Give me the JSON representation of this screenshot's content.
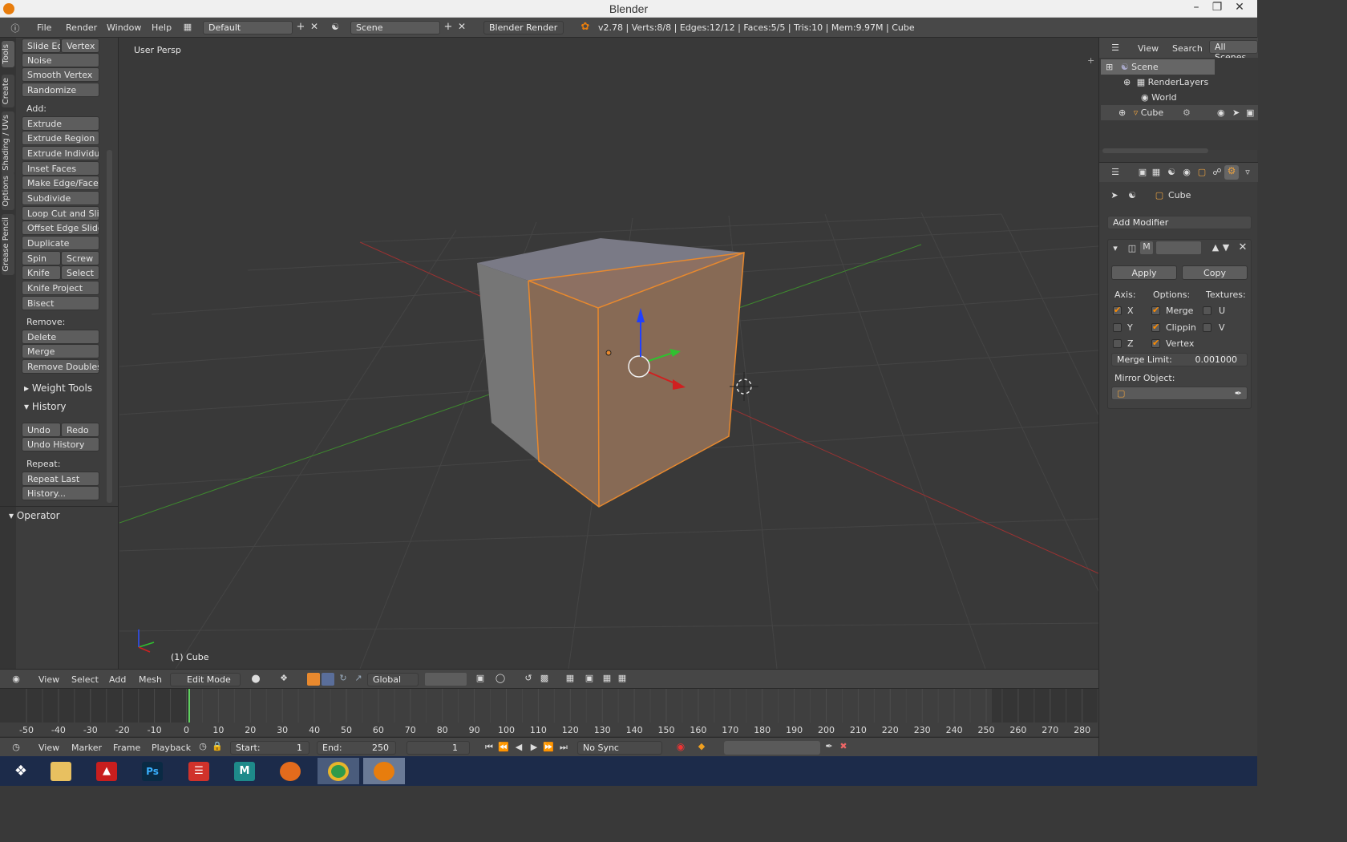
{
  "window": {
    "title": "Blender"
  },
  "info": {
    "menus": [
      "File",
      "Render",
      "Window",
      "Help"
    ],
    "layout": "Default",
    "scene": "Scene",
    "engine": "Blender Render",
    "stats": "v2.78 | Verts:8/8 | Edges:12/12 | Faces:5/5 | Tris:10 | Mem:9.97M | Cube"
  },
  "toolshelf": {
    "tabs": [
      "Tools",
      "Create",
      "Shading / UVs",
      "Options",
      "Grease Pencil"
    ],
    "top_row": [
      "Slide Ed",
      "Vertex"
    ],
    "deform_buttons": [
      "Noise",
      "Smooth Vertex",
      "Randomize"
    ],
    "add_label": "Add:",
    "add_buttons": [
      "Extrude",
      "Extrude Region",
      "Extrude Individual",
      "Inset Faces",
      "Make Edge/Face",
      "Subdivide",
      "Loop Cut and Slide",
      "Offset Edge Slide",
      "Duplicate"
    ],
    "spin": "Spin",
    "screw": "Screw",
    "knife": "Knife",
    "select": "Select",
    "knife_project": "Knife Project",
    "bisect": "Bisect",
    "remove_label": "Remove:",
    "remove_buttons": [
      "Delete",
      "Merge",
      "Remove Doubles"
    ],
    "weight_tools": "Weight Tools",
    "history": "History",
    "undo": "Undo",
    "redo": "Redo",
    "undo_history": "Undo History",
    "repeat_label": "Repeat:",
    "repeat_last": "Repeat Last",
    "history_dots": "History...",
    "operator": "Operator"
  },
  "viewport": {
    "label": "User Persp",
    "object": "(1) Cube"
  },
  "view_header": {
    "menus": [
      "View",
      "Select",
      "Add",
      "Mesh"
    ],
    "mode": "Edit Mode",
    "orientation": "Global"
  },
  "timeline": {
    "ticks": [
      -50,
      -40,
      -30,
      -20,
      -10,
      0,
      10,
      20,
      30,
      40,
      50,
      60,
      70,
      80,
      90,
      100,
      110,
      120,
      130,
      140,
      150,
      160,
      170,
      180,
      190,
      200,
      210,
      220,
      230,
      240,
      250,
      260,
      270,
      280
    ],
    "current_frame": 1,
    "menus": [
      "View",
      "Marker",
      "Frame",
      "Playback"
    ],
    "start_label": "Start:",
    "start": "1",
    "end_label": "End:",
    "end": "250",
    "frame": "1",
    "sync": "No Sync"
  },
  "outliner": {
    "menus": [
      "View",
      "Search"
    ],
    "filter": "All Scenes",
    "items": [
      "Scene",
      "RenderLayers",
      "World",
      "Cube"
    ]
  },
  "properties": {
    "object": "Cube",
    "add_modifier": "Add Modifier",
    "mod_short": "M",
    "apply": "Apply",
    "copy": "Copy",
    "axis_label": "Axis:",
    "options_label": "Options:",
    "textures_label": "Textures:",
    "x": "X",
    "y": "Y",
    "z": "Z",
    "merge": "Merge",
    "clipping": "Clippin",
    "vertex": "Vertex",
    "u": "U",
    "v": "V",
    "merge_limit_label": "Merge Limit:",
    "merge_limit": "0.001000",
    "mirror_object_label": "Mirror Object:"
  },
  "taskbar": {
    "apps": [
      "windows-start",
      "file-explorer",
      "acrobat",
      "photoshop",
      "sketchup",
      "maya",
      "firefox",
      "chrome",
      "blender"
    ]
  },
  "colors": {
    "accent": "#ff8c00",
    "selection": "#e8892e",
    "taskbar": "#1c2b4a"
  }
}
